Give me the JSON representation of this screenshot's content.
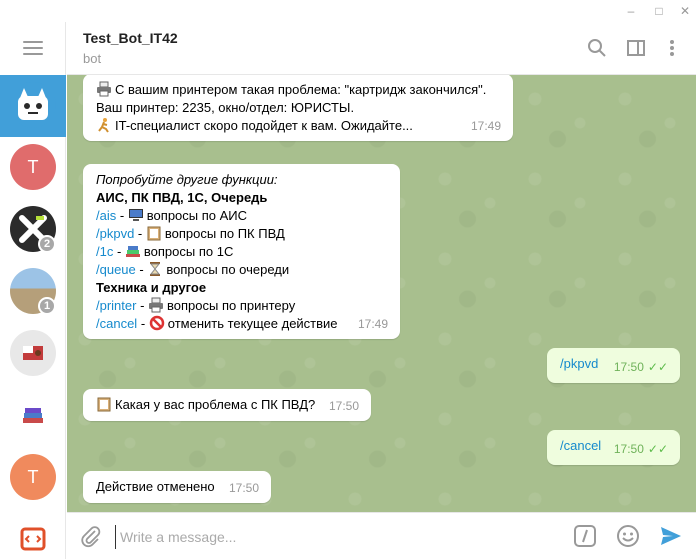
{
  "window": {
    "minimize_glyph": "–",
    "maximize_glyph": "□",
    "close_glyph": "✕"
  },
  "sidebar": {
    "menu_icon": "hamburger-menu-icon",
    "chats": [
      {
        "id": "bot",
        "avatar": "bot-avatar",
        "letter": "",
        "color": "#419fd9",
        "badge": "",
        "active": true
      },
      {
        "id": "t1",
        "avatar": "letter-avatar",
        "letter": "T",
        "color": "#e06c6c",
        "badge": ""
      },
      {
        "id": "x",
        "avatar": "x-logo-avatar",
        "letter": "",
        "color": "#2b2b2b",
        "badge": "2"
      },
      {
        "id": "photo",
        "avatar": "photo-avatar",
        "letter": "",
        "color": "#8da4b8",
        "badge": "1"
      },
      {
        "id": "flag",
        "avatar": "flag-avatar",
        "letter": "",
        "color": "#e8e8e8",
        "badge": ""
      },
      {
        "id": "books",
        "avatar": "books-avatar",
        "letter": "",
        "color": "#ffffff",
        "badge": ""
      },
      {
        "id": "t2",
        "avatar": "letter-avatar",
        "letter": "T",
        "color": "#f08a5d",
        "badge": ""
      },
      {
        "id": "code",
        "avatar": "code-avatar",
        "letter": "",
        "color": "#ffffff",
        "badge": ""
      }
    ]
  },
  "header": {
    "title": "Test_Bot_IT42",
    "subtitle": "bot",
    "icons": [
      "search-icon",
      "sidebar-toggle-icon",
      "more-vertical-icon"
    ]
  },
  "messages": {
    "m1": {
      "line1": "С вашим принтером такая проблема: \"картридж закончился\".",
      "line2": "Ваш принтер: 2235, окно/отдел: ЮРИСТЫ.",
      "line3": "IT-специалист скоро подойдет к вам.  Ожидайте...",
      "time": "17:49"
    },
    "m2": {
      "intro": "Попробуйте другие функции:",
      "section1": "АИС, ПК ПВД, 1С, Очередь",
      "items1": [
        {
          "cmd": "/ais",
          "sep": " - ",
          "text": "вопросы по АИС"
        },
        {
          "cmd": "/pkpvd",
          "sep": " - ",
          "text": "вопросы по ПК ПВД"
        },
        {
          "cmd": "/1c",
          "sep": " - ",
          "text": "вопросы по 1С"
        },
        {
          "cmd": "/queue",
          "sep": " - ",
          "text": "вопросы по очереди"
        }
      ],
      "section2": "Техника и другое",
      "items2": [
        {
          "cmd": "/printer",
          "sep": " - ",
          "text": "вопросы по принтеру"
        },
        {
          "cmd": "/cancel",
          "sep": " - ",
          "text": "отменить текущее действие"
        }
      ],
      "time": "17:49"
    },
    "m3": {
      "text": "/pkpvd",
      "time": "17:50",
      "ticks": "✓✓"
    },
    "m4": {
      "text": "Какая у вас проблема с ПК ПВД?",
      "time": "17:50"
    },
    "m5": {
      "text": "/cancel",
      "time": "17:50",
      "ticks": "✓✓"
    },
    "m6": {
      "text": "Действие отменено",
      "time": "17:50"
    }
  },
  "composer": {
    "placeholder": "Write a message...",
    "icons": [
      "attach-icon",
      "commands-icon",
      "emoji-icon",
      "send-icon"
    ],
    "accent": "#419fd9"
  },
  "colors": {
    "chat_bg": "#a8bf8e",
    "outgoing_bubble": "#effdde",
    "link": "#168acd",
    "active_chat": "#419fd9"
  }
}
